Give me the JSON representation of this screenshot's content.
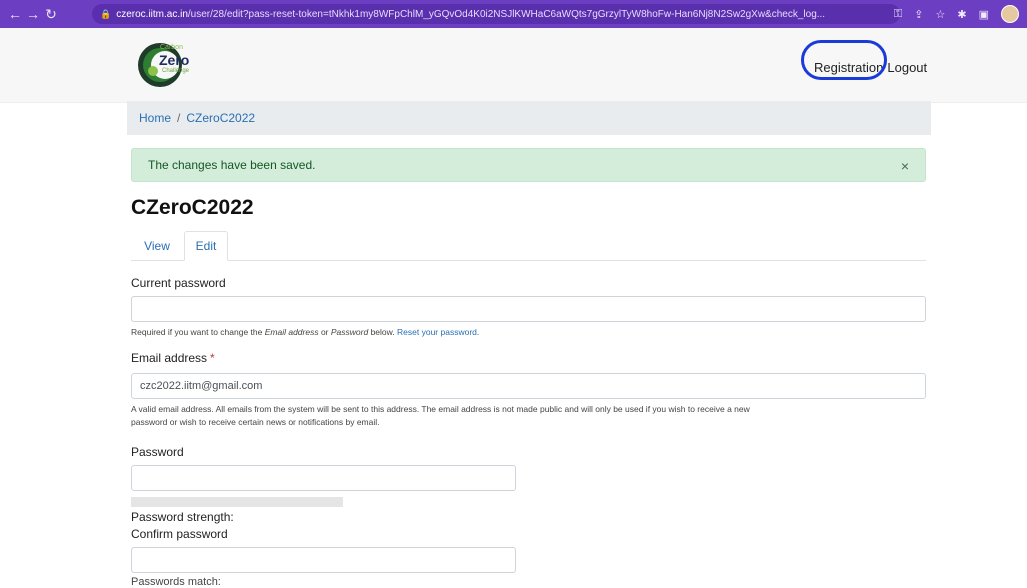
{
  "browser": {
    "url_host": "czeroc.iitm.ac.in",
    "url_path": "/user/28/edit?pass-reset-token=tNkhk1my8WFpChlM_yGQvOd4K0i2NSJlKWHaC6aWQts7gGrzylTyW8hoFw-Han6Nj8N2Sw2gXw&check_log..."
  },
  "header": {
    "logo_top": "Carbon",
    "logo_main": "Zero",
    "logo_sub": "Challenge",
    "registration_label": "Registration",
    "logout_label": "Logout"
  },
  "breadcrumb": {
    "home": "Home",
    "separator": "/",
    "current": "CZeroC2022"
  },
  "alert": {
    "message": "The changes have been saved.",
    "close": "×"
  },
  "page": {
    "title": "CZeroC2022"
  },
  "tabs": {
    "view": "View",
    "edit": "Edit"
  },
  "form": {
    "current_password": {
      "label": "Current password",
      "value": "",
      "help_prefix": "Required if you want to change the ",
      "help_em1": "Email address",
      "help_mid": " or ",
      "help_em2": "Password",
      "help_suffix": " below. ",
      "help_link": "Reset your password",
      "help_end": "."
    },
    "email": {
      "label": "Email address",
      "required_mark": "*",
      "value": "czc2022.iitm@gmail.com",
      "help_line1": "A valid email address. All emails from the system will be sent to this address. The email address is not made public and will only be used if you wish to receive a new",
      "help_line2": "password or wish to receive certain news or notifications by email."
    },
    "password": {
      "label": "Password",
      "value": "",
      "strength_label": "Password strength:"
    },
    "confirm_password": {
      "label": "Confirm password",
      "value": "",
      "match_label": "Passwords match:"
    }
  },
  "colors": {
    "browser_bar": "#6c3fc2",
    "link": "#2a6fb3",
    "alert_bg": "#d4edda",
    "annotation": "#1a3bd8"
  }
}
